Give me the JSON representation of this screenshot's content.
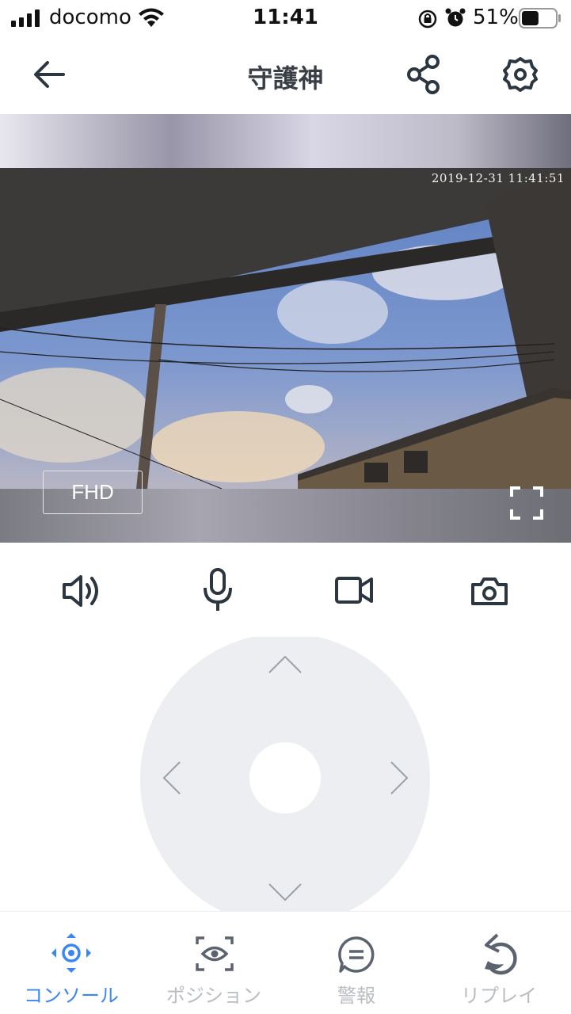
{
  "status_bar": {
    "carrier": "docomo",
    "time": "11:41",
    "battery_percent": "51%",
    "battery_level": 0.51
  },
  "nav": {
    "title": "守護神"
  },
  "video": {
    "timestamp": "2019-12-31  11:41:51",
    "quality_label": "FHD"
  },
  "tabs": [
    {
      "label": "コンソール",
      "active": true
    },
    {
      "label": "ポジション",
      "active": false
    },
    {
      "label": "警報",
      "active": false
    },
    {
      "label": "リプレイ",
      "active": false
    }
  ],
  "colors": {
    "accent": "#3a86f5",
    "icon": "#2b3640",
    "inactive": "#b9bcc1",
    "joystick": "#eceef1"
  }
}
